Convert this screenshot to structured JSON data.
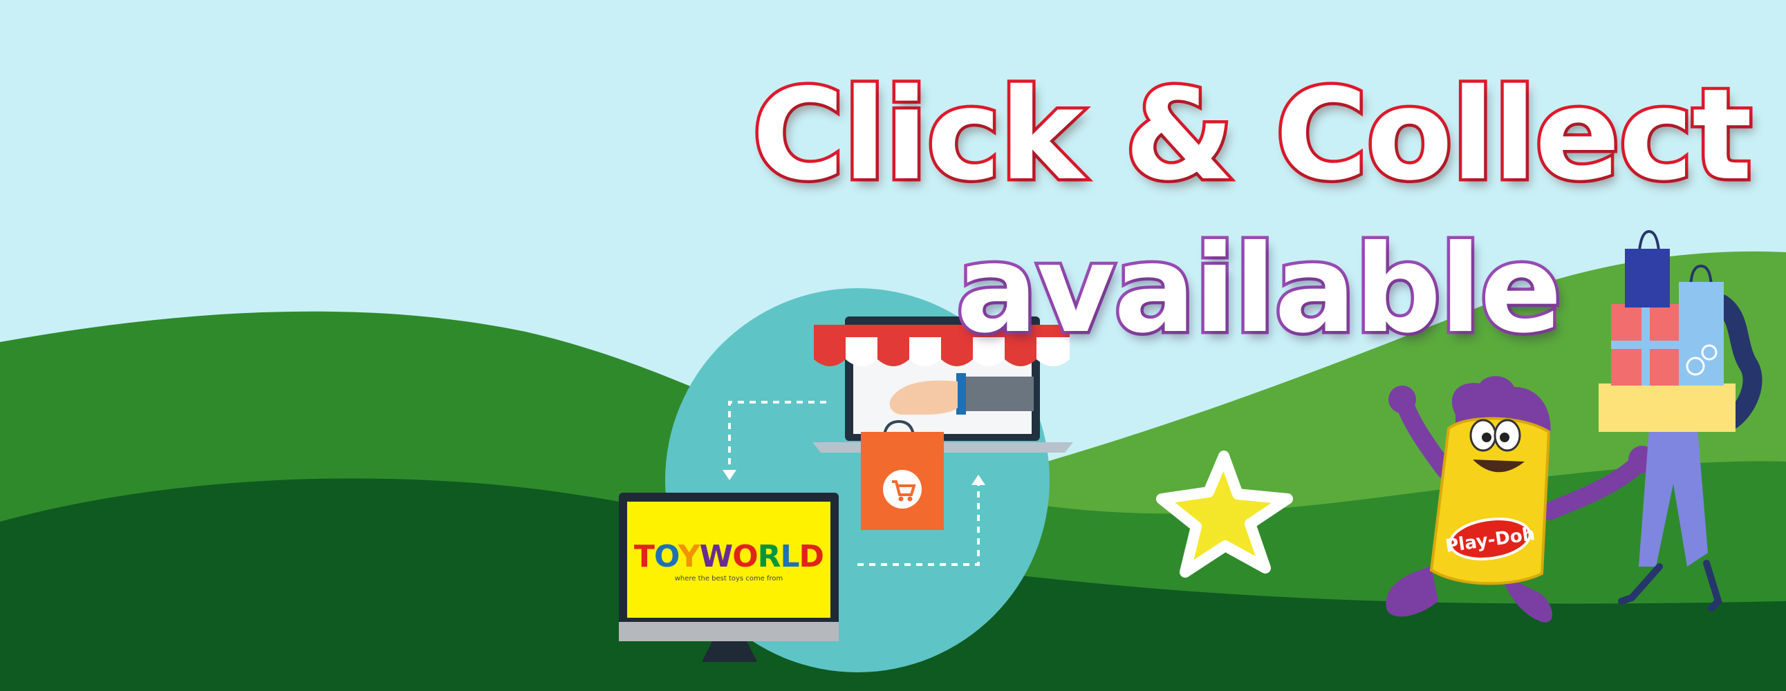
{
  "headline": {
    "main": "Click & Collect",
    "sub": "available"
  },
  "store_logo": {
    "letters": [
      "T",
      "O",
      "Y",
      "W",
      "O",
      "R",
      "L",
      "D"
    ],
    "letter_colors": [
      "#e2231a",
      "#1d71b8",
      "#f39200",
      "#6a2c91",
      "#e2231a",
      "#009640",
      "#1d71b8",
      "#e2231a"
    ],
    "tagline": "where the best toys come from"
  },
  "product_label": "Play-Doh",
  "colors": {
    "sky": "#c9f0f6",
    "hill_light": "#5aab3c",
    "hill_mid": "#2f8a2c",
    "hill_dark": "#0e5a20",
    "headline_outline": "#e3192c",
    "subline_outline": "#9b4bb6",
    "circle": "#5fc4c6",
    "awning_red": "#e23a36",
    "bag_orange": "#f26a2e",
    "monitor_screen": "#fff200",
    "star": "#f4e72a"
  },
  "icons": [
    "shopping-cart-icon",
    "star-icon",
    "arrow-down-icon",
    "arrow-up-icon"
  ]
}
